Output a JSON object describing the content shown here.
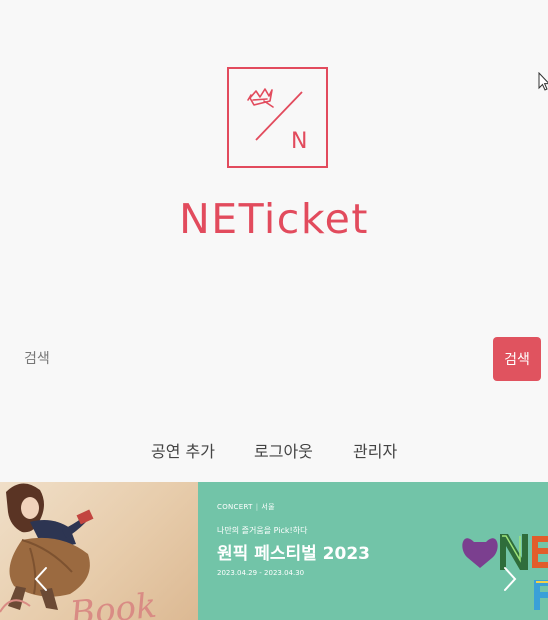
{
  "brand": {
    "logo_letter": "N",
    "name": "NETicket",
    "accent_color": "#e24b5d"
  },
  "search": {
    "placeholder": "검색",
    "button_label": "검색",
    "button_color": "#e0535f"
  },
  "nav": {
    "items": [
      {
        "label": "공연 추가"
      },
      {
        "label": "로그아웃"
      },
      {
        "label": "관리자"
      }
    ]
  },
  "carousel": {
    "slide_left": {
      "text": "Book"
    },
    "slide_right": {
      "category": "CONCERT",
      "region": "서울",
      "subtitle": "나만의 즐거움을 Pick!하다",
      "title": "원픽 페스티벌 2023",
      "dates": "2023.04.29 - 2023.04.30",
      "background_color": "#72c4a8"
    },
    "prev_icon": "chevron-left-icon",
    "next_icon": "chevron-right-icon"
  }
}
